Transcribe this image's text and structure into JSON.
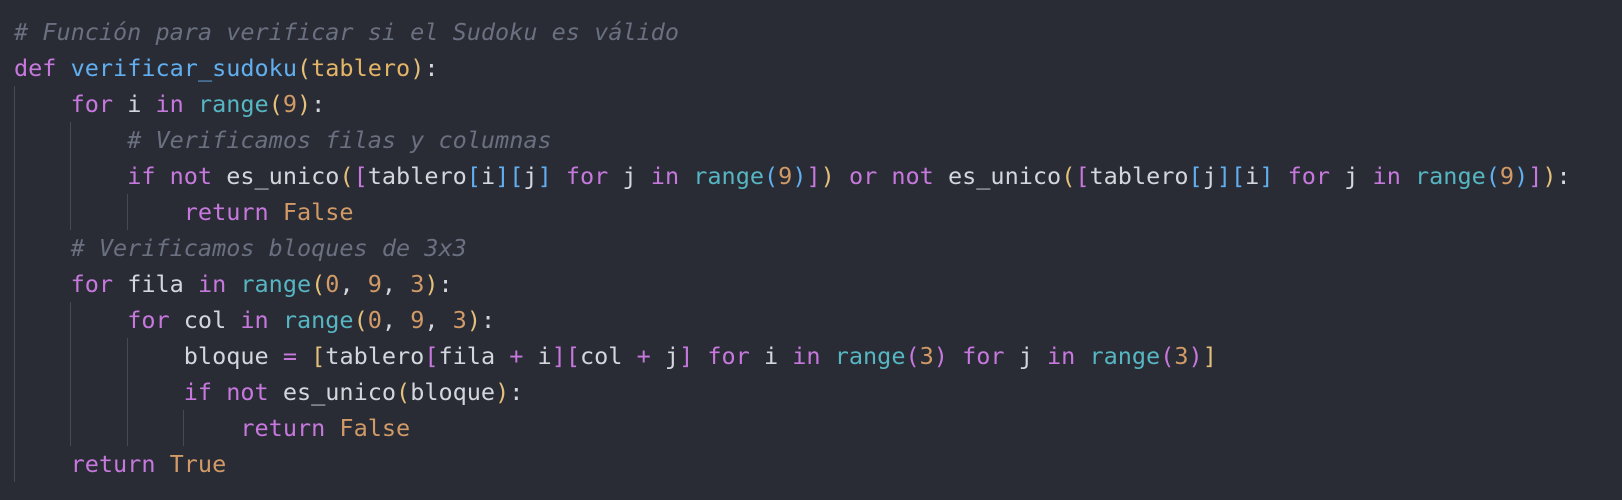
{
  "editor": {
    "language": "python",
    "background": "#292c35",
    "lines": [
      {
        "indent": 0,
        "tokens": [
          {
            "t": "comment",
            "v": "# Función para verificar si el Sudoku es válido"
          }
        ]
      },
      {
        "indent": 0,
        "tokens": [
          {
            "t": "keyword",
            "v": "def"
          },
          {
            "t": "plain",
            "v": " "
          },
          {
            "t": "func",
            "v": "verificar_sudoku"
          },
          {
            "t": "b1",
            "v": "("
          },
          {
            "t": "param",
            "v": "tablero"
          },
          {
            "t": "b1",
            "v": ")"
          },
          {
            "t": "plain",
            "v": ":"
          }
        ]
      },
      {
        "indent": 1,
        "tokens": [
          {
            "t": "keyword",
            "v": "for"
          },
          {
            "t": "plain",
            "v": " i "
          },
          {
            "t": "keyword",
            "v": "in"
          },
          {
            "t": "plain",
            "v": " "
          },
          {
            "t": "builtin",
            "v": "range"
          },
          {
            "t": "b1",
            "v": "("
          },
          {
            "t": "number",
            "v": "9"
          },
          {
            "t": "b1",
            "v": ")"
          },
          {
            "t": "plain",
            "v": ":"
          }
        ]
      },
      {
        "indent": 2,
        "tokens": [
          {
            "t": "comment",
            "v": "# Verificamos filas y columnas"
          }
        ]
      },
      {
        "indent": 2,
        "tokens": [
          {
            "t": "keyword",
            "v": "if"
          },
          {
            "t": "plain",
            "v": " "
          },
          {
            "t": "keyword",
            "v": "not"
          },
          {
            "t": "plain",
            "v": " es_unico"
          },
          {
            "t": "b1",
            "v": "("
          },
          {
            "t": "b2",
            "v": "["
          },
          {
            "t": "plain",
            "v": "tablero"
          },
          {
            "t": "b3",
            "v": "["
          },
          {
            "t": "plain",
            "v": "i"
          },
          {
            "t": "b3",
            "v": "]"
          },
          {
            "t": "b3",
            "v": "["
          },
          {
            "t": "plain",
            "v": "j"
          },
          {
            "t": "b3",
            "v": "]"
          },
          {
            "t": "plain",
            "v": " "
          },
          {
            "t": "keyword",
            "v": "for"
          },
          {
            "t": "plain",
            "v": " j "
          },
          {
            "t": "keyword",
            "v": "in"
          },
          {
            "t": "plain",
            "v": " "
          },
          {
            "t": "builtin",
            "v": "range"
          },
          {
            "t": "b3",
            "v": "("
          },
          {
            "t": "number",
            "v": "9"
          },
          {
            "t": "b3",
            "v": ")"
          },
          {
            "t": "b2",
            "v": "]"
          },
          {
            "t": "b1",
            "v": ")"
          },
          {
            "t": "plain",
            "v": " "
          },
          {
            "t": "keyword",
            "v": "or"
          },
          {
            "t": "plain",
            "v": " "
          },
          {
            "t": "keyword",
            "v": "not"
          },
          {
            "t": "plain",
            "v": " es_unico"
          },
          {
            "t": "b1",
            "v": "("
          },
          {
            "t": "b2",
            "v": "["
          },
          {
            "t": "plain",
            "v": "tablero"
          },
          {
            "t": "b3",
            "v": "["
          },
          {
            "t": "plain",
            "v": "j"
          },
          {
            "t": "b3",
            "v": "]"
          },
          {
            "t": "b3",
            "v": "["
          },
          {
            "t": "plain",
            "v": "i"
          },
          {
            "t": "b3",
            "v": "]"
          },
          {
            "t": "plain",
            "v": " "
          },
          {
            "t": "keyword",
            "v": "for"
          },
          {
            "t": "plain",
            "v": " j "
          },
          {
            "t": "keyword",
            "v": "in"
          },
          {
            "t": "plain",
            "v": " "
          },
          {
            "t": "builtin",
            "v": "range"
          },
          {
            "t": "b3",
            "v": "("
          },
          {
            "t": "number",
            "v": "9"
          },
          {
            "t": "b3",
            "v": ")"
          },
          {
            "t": "b2",
            "v": "]"
          },
          {
            "t": "b1",
            "v": ")"
          },
          {
            "t": "plain",
            "v": ":"
          }
        ]
      },
      {
        "indent": 3,
        "tokens": [
          {
            "t": "keyword",
            "v": "return"
          },
          {
            "t": "plain",
            "v": " "
          },
          {
            "t": "const",
            "v": "False"
          }
        ]
      },
      {
        "indent": 1,
        "tokens": [
          {
            "t": "comment",
            "v": "# Verificamos bloques de 3x3"
          }
        ]
      },
      {
        "indent": 1,
        "tokens": [
          {
            "t": "keyword",
            "v": "for"
          },
          {
            "t": "plain",
            "v": " fila "
          },
          {
            "t": "keyword",
            "v": "in"
          },
          {
            "t": "plain",
            "v": " "
          },
          {
            "t": "builtin",
            "v": "range"
          },
          {
            "t": "b1",
            "v": "("
          },
          {
            "t": "number",
            "v": "0"
          },
          {
            "t": "plain",
            "v": ", "
          },
          {
            "t": "number",
            "v": "9"
          },
          {
            "t": "plain",
            "v": ", "
          },
          {
            "t": "number",
            "v": "3"
          },
          {
            "t": "b1",
            "v": ")"
          },
          {
            "t": "plain",
            "v": ":"
          }
        ]
      },
      {
        "indent": 2,
        "tokens": [
          {
            "t": "keyword",
            "v": "for"
          },
          {
            "t": "plain",
            "v": " col "
          },
          {
            "t": "keyword",
            "v": "in"
          },
          {
            "t": "plain",
            "v": " "
          },
          {
            "t": "builtin",
            "v": "range"
          },
          {
            "t": "b1",
            "v": "("
          },
          {
            "t": "number",
            "v": "0"
          },
          {
            "t": "plain",
            "v": ", "
          },
          {
            "t": "number",
            "v": "9"
          },
          {
            "t": "plain",
            "v": ", "
          },
          {
            "t": "number",
            "v": "3"
          },
          {
            "t": "b1",
            "v": ")"
          },
          {
            "t": "plain",
            "v": ":"
          }
        ]
      },
      {
        "indent": 3,
        "tokens": [
          {
            "t": "plain",
            "v": "bloque "
          },
          {
            "t": "op",
            "v": "="
          },
          {
            "t": "plain",
            "v": " "
          },
          {
            "t": "b1",
            "v": "["
          },
          {
            "t": "plain",
            "v": "tablero"
          },
          {
            "t": "b2",
            "v": "["
          },
          {
            "t": "plain",
            "v": "fila "
          },
          {
            "t": "op",
            "v": "+"
          },
          {
            "t": "plain",
            "v": " i"
          },
          {
            "t": "b2",
            "v": "]"
          },
          {
            "t": "b2",
            "v": "["
          },
          {
            "t": "plain",
            "v": "col "
          },
          {
            "t": "op",
            "v": "+"
          },
          {
            "t": "plain",
            "v": " j"
          },
          {
            "t": "b2",
            "v": "]"
          },
          {
            "t": "plain",
            "v": " "
          },
          {
            "t": "keyword",
            "v": "for"
          },
          {
            "t": "plain",
            "v": " i "
          },
          {
            "t": "keyword",
            "v": "in"
          },
          {
            "t": "plain",
            "v": " "
          },
          {
            "t": "builtin",
            "v": "range"
          },
          {
            "t": "b2",
            "v": "("
          },
          {
            "t": "number",
            "v": "3"
          },
          {
            "t": "b2",
            "v": ")"
          },
          {
            "t": "plain",
            "v": " "
          },
          {
            "t": "keyword",
            "v": "for"
          },
          {
            "t": "plain",
            "v": " j "
          },
          {
            "t": "keyword",
            "v": "in"
          },
          {
            "t": "plain",
            "v": " "
          },
          {
            "t": "builtin",
            "v": "range"
          },
          {
            "t": "b2",
            "v": "("
          },
          {
            "t": "number",
            "v": "3"
          },
          {
            "t": "b2",
            "v": ")"
          },
          {
            "t": "b1",
            "v": "]"
          }
        ]
      },
      {
        "indent": 3,
        "tokens": [
          {
            "t": "keyword",
            "v": "if"
          },
          {
            "t": "plain",
            "v": " "
          },
          {
            "t": "keyword",
            "v": "not"
          },
          {
            "t": "plain",
            "v": " es_unico"
          },
          {
            "t": "b1",
            "v": "("
          },
          {
            "t": "plain",
            "v": "bloque"
          },
          {
            "t": "b1",
            "v": ")"
          },
          {
            "t": "plain",
            "v": ":"
          }
        ]
      },
      {
        "indent": 4,
        "tokens": [
          {
            "t": "keyword",
            "v": "return"
          },
          {
            "t": "plain",
            "v": " "
          },
          {
            "t": "const",
            "v": "False"
          }
        ]
      },
      {
        "indent": 1,
        "tokens": [
          {
            "t": "keyword",
            "v": "return"
          },
          {
            "t": "plain",
            "v": " "
          },
          {
            "t": "const",
            "v": "True"
          }
        ]
      }
    ]
  }
}
